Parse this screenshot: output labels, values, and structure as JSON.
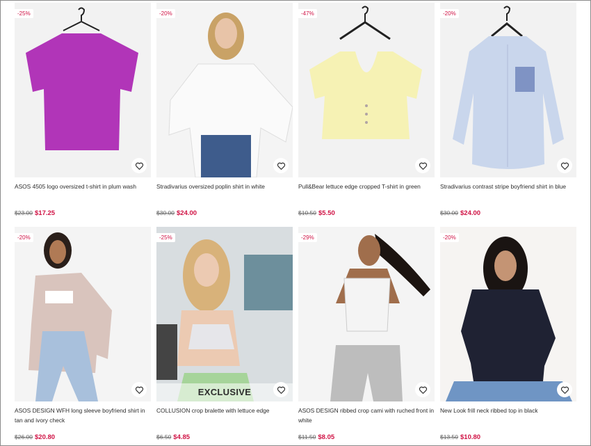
{
  "colors": {
    "sale_red": "#d01345",
    "text": "#2d2d2d",
    "old_price": "#666666",
    "photo_bg": "#f1f1f1"
  },
  "icons": {
    "save": "heart-icon"
  },
  "products": [
    {
      "discount": "-25%",
      "name": "ASOS 4505 logo oversized t-shirt in plum wash",
      "old_price": "$23.00",
      "price": "$17.25",
      "exclusive": "",
      "garment_color": "#b135b8"
    },
    {
      "discount": "-20%",
      "name": "Stradivarius oversized poplin shirt in white",
      "old_price": "$30.00",
      "price": "$24.00",
      "exclusive": "",
      "garment_color": "#fafafa"
    },
    {
      "discount": "-47%",
      "name": "Pull&Bear lettuce edge cropped T-shirt in green",
      "old_price": "$10.50",
      "price": "$5.50",
      "exclusive": "",
      "garment_color": "#f6f2b4"
    },
    {
      "discount": "-20%",
      "name": "Stradivarius contrast stripe boyfriend shirt in blue",
      "old_price": "$30.00",
      "price": "$24.00",
      "exclusive": "",
      "garment_color": "#c9d6ec"
    },
    {
      "discount": "-20%",
      "name": "ASOS DESIGN WFH long sleeve boyfriend shirt in tan and ivory check",
      "old_price": "$26.00",
      "price": "$20.80",
      "exclusive": "",
      "garment_color": "#d9c4bd"
    },
    {
      "discount": "-25%",
      "name": "COLLUSION crop bralette with lettuce edge",
      "old_price": "$6.50",
      "price": "$4.85",
      "exclusive": "EXCLUSIVE",
      "garment_color": "#e6e6ea"
    },
    {
      "discount": "-29%",
      "name": "ASOS DESIGN ribbed crop cami with ruched front in white",
      "old_price": "$11.50",
      "price": "$8.05",
      "exclusive": "",
      "garment_color": "#f4f4f4"
    },
    {
      "discount": "-20%",
      "name": "New Look frill neck ribbed top in black",
      "old_price": "$13.50",
      "price": "$10.80",
      "exclusive": "",
      "garment_color": "#1f2233"
    }
  ]
}
